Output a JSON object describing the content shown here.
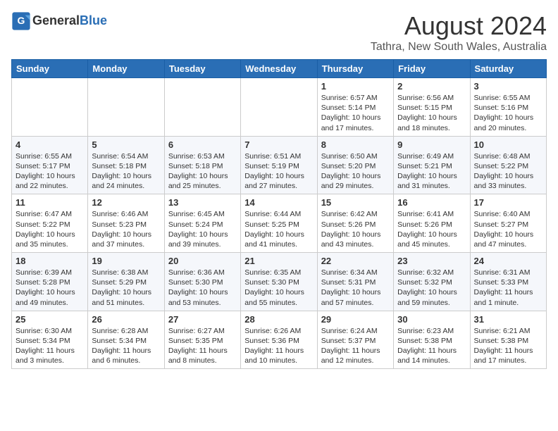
{
  "header": {
    "logo_general": "General",
    "logo_blue": "Blue",
    "month_title": "August 2024",
    "location": "Tathra, New South Wales, Australia"
  },
  "weekdays": [
    "Sunday",
    "Monday",
    "Tuesday",
    "Wednesday",
    "Thursday",
    "Friday",
    "Saturday"
  ],
  "weeks": [
    [
      {
        "day": "",
        "info": ""
      },
      {
        "day": "",
        "info": ""
      },
      {
        "day": "",
        "info": ""
      },
      {
        "day": "",
        "info": ""
      },
      {
        "day": "1",
        "info": "Sunrise: 6:57 AM\nSunset: 5:14 PM\nDaylight: 10 hours\nand 17 minutes."
      },
      {
        "day": "2",
        "info": "Sunrise: 6:56 AM\nSunset: 5:15 PM\nDaylight: 10 hours\nand 18 minutes."
      },
      {
        "day": "3",
        "info": "Sunrise: 6:55 AM\nSunset: 5:16 PM\nDaylight: 10 hours\nand 20 minutes."
      }
    ],
    [
      {
        "day": "4",
        "info": "Sunrise: 6:55 AM\nSunset: 5:17 PM\nDaylight: 10 hours\nand 22 minutes."
      },
      {
        "day": "5",
        "info": "Sunrise: 6:54 AM\nSunset: 5:18 PM\nDaylight: 10 hours\nand 24 minutes."
      },
      {
        "day": "6",
        "info": "Sunrise: 6:53 AM\nSunset: 5:18 PM\nDaylight: 10 hours\nand 25 minutes."
      },
      {
        "day": "7",
        "info": "Sunrise: 6:51 AM\nSunset: 5:19 PM\nDaylight: 10 hours\nand 27 minutes."
      },
      {
        "day": "8",
        "info": "Sunrise: 6:50 AM\nSunset: 5:20 PM\nDaylight: 10 hours\nand 29 minutes."
      },
      {
        "day": "9",
        "info": "Sunrise: 6:49 AM\nSunset: 5:21 PM\nDaylight: 10 hours\nand 31 minutes."
      },
      {
        "day": "10",
        "info": "Sunrise: 6:48 AM\nSunset: 5:22 PM\nDaylight: 10 hours\nand 33 minutes."
      }
    ],
    [
      {
        "day": "11",
        "info": "Sunrise: 6:47 AM\nSunset: 5:22 PM\nDaylight: 10 hours\nand 35 minutes."
      },
      {
        "day": "12",
        "info": "Sunrise: 6:46 AM\nSunset: 5:23 PM\nDaylight: 10 hours\nand 37 minutes."
      },
      {
        "day": "13",
        "info": "Sunrise: 6:45 AM\nSunset: 5:24 PM\nDaylight: 10 hours\nand 39 minutes."
      },
      {
        "day": "14",
        "info": "Sunrise: 6:44 AM\nSunset: 5:25 PM\nDaylight: 10 hours\nand 41 minutes."
      },
      {
        "day": "15",
        "info": "Sunrise: 6:42 AM\nSunset: 5:26 PM\nDaylight: 10 hours\nand 43 minutes."
      },
      {
        "day": "16",
        "info": "Sunrise: 6:41 AM\nSunset: 5:26 PM\nDaylight: 10 hours\nand 45 minutes."
      },
      {
        "day": "17",
        "info": "Sunrise: 6:40 AM\nSunset: 5:27 PM\nDaylight: 10 hours\nand 47 minutes."
      }
    ],
    [
      {
        "day": "18",
        "info": "Sunrise: 6:39 AM\nSunset: 5:28 PM\nDaylight: 10 hours\nand 49 minutes."
      },
      {
        "day": "19",
        "info": "Sunrise: 6:38 AM\nSunset: 5:29 PM\nDaylight: 10 hours\nand 51 minutes."
      },
      {
        "day": "20",
        "info": "Sunrise: 6:36 AM\nSunset: 5:30 PM\nDaylight: 10 hours\nand 53 minutes."
      },
      {
        "day": "21",
        "info": "Sunrise: 6:35 AM\nSunset: 5:30 PM\nDaylight: 10 hours\nand 55 minutes."
      },
      {
        "day": "22",
        "info": "Sunrise: 6:34 AM\nSunset: 5:31 PM\nDaylight: 10 hours\nand 57 minutes."
      },
      {
        "day": "23",
        "info": "Sunrise: 6:32 AM\nSunset: 5:32 PM\nDaylight: 10 hours\nand 59 minutes."
      },
      {
        "day": "24",
        "info": "Sunrise: 6:31 AM\nSunset: 5:33 PM\nDaylight: 11 hours\nand 1 minute."
      }
    ],
    [
      {
        "day": "25",
        "info": "Sunrise: 6:30 AM\nSunset: 5:34 PM\nDaylight: 11 hours\nand 3 minutes."
      },
      {
        "day": "26",
        "info": "Sunrise: 6:28 AM\nSunset: 5:34 PM\nDaylight: 11 hours\nand 6 minutes."
      },
      {
        "day": "27",
        "info": "Sunrise: 6:27 AM\nSunset: 5:35 PM\nDaylight: 11 hours\nand 8 minutes."
      },
      {
        "day": "28",
        "info": "Sunrise: 6:26 AM\nSunset: 5:36 PM\nDaylight: 11 hours\nand 10 minutes."
      },
      {
        "day": "29",
        "info": "Sunrise: 6:24 AM\nSunset: 5:37 PM\nDaylight: 11 hours\nand 12 minutes."
      },
      {
        "day": "30",
        "info": "Sunrise: 6:23 AM\nSunset: 5:38 PM\nDaylight: 11 hours\nand 14 minutes."
      },
      {
        "day": "31",
        "info": "Sunrise: 6:21 AM\nSunset: 5:38 PM\nDaylight: 11 hours\nand 17 minutes."
      }
    ]
  ]
}
